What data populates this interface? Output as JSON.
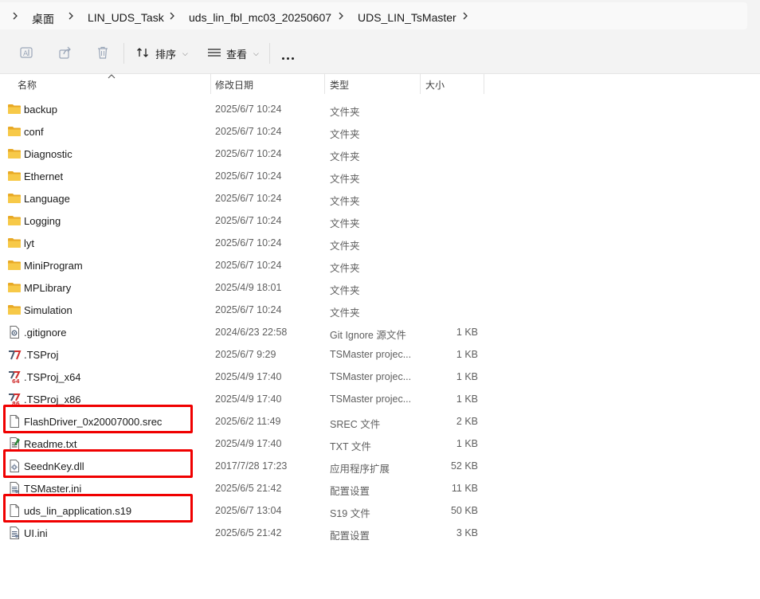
{
  "breadcrumb": [
    "桌面",
    "LIN_UDS_Task",
    "uds_lin_fbl_mc03_20250607",
    "UDS_LIN_TsMaster"
  ],
  "toolbar": {
    "sort_label": "排序",
    "view_label": "查看"
  },
  "columns": {
    "name": "名称",
    "date": "修改日期",
    "type": "类型",
    "size": "大小"
  },
  "colors": {
    "highlight": "#f00000",
    "folder": "#f7c948"
  },
  "files": [
    {
      "name": "backup",
      "date": "2025/6/7 10:24",
      "type": "文件夹",
      "size": "",
      "icon": "folder-icon",
      "highlight": false
    },
    {
      "name": "conf",
      "date": "2025/6/7 10:24",
      "type": "文件夹",
      "size": "",
      "icon": "folder-icon",
      "highlight": false
    },
    {
      "name": "Diagnostic",
      "date": "2025/6/7 10:24",
      "type": "文件夹",
      "size": "",
      "icon": "folder-icon",
      "highlight": false
    },
    {
      "name": "Ethernet",
      "date": "2025/6/7 10:24",
      "type": "文件夹",
      "size": "",
      "icon": "folder-icon",
      "highlight": false
    },
    {
      "name": "Language",
      "date": "2025/6/7 10:24",
      "type": "文件夹",
      "size": "",
      "icon": "folder-icon",
      "highlight": false
    },
    {
      "name": "Logging",
      "date": "2025/6/7 10:24",
      "type": "文件夹",
      "size": "",
      "icon": "folder-icon",
      "highlight": false
    },
    {
      "name": "lyt",
      "date": "2025/6/7 10:24",
      "type": "文件夹",
      "size": "",
      "icon": "folder-icon",
      "highlight": false
    },
    {
      "name": "MiniProgram",
      "date": "2025/6/7 10:24",
      "type": "文件夹",
      "size": "",
      "icon": "folder-icon",
      "highlight": false
    },
    {
      "name": "MPLibrary",
      "date": "2025/4/9 18:01",
      "type": "文件夹",
      "size": "",
      "icon": "folder-icon",
      "highlight": false
    },
    {
      "name": "Simulation",
      "date": "2025/6/7 10:24",
      "type": "文件夹",
      "size": "",
      "icon": "folder-icon",
      "highlight": false
    },
    {
      "name": ".gitignore",
      "date": "2024/6/23 22:58",
      "type": "Git Ignore 源文件",
      "size": "1 KB",
      "icon": "gear-file-icon",
      "highlight": false
    },
    {
      "name": ".TSProj",
      "date": "2025/6/7 9:29",
      "type": "TSMaster projec...",
      "size": "1 KB",
      "icon": "tsmaster-icon",
      "highlight": false
    },
    {
      "name": ".TSProj_x64",
      "date": "2025/4/9 17:40",
      "type": "TSMaster projec...",
      "size": "1 KB",
      "icon": "tsmaster-x64-icon",
      "highlight": false
    },
    {
      "name": ".TSProj_x86",
      "date": "2025/4/9 17:40",
      "type": "TSMaster projec...",
      "size": "1 KB",
      "icon": "tsmaster-x86-icon",
      "highlight": false
    },
    {
      "name": "FlashDriver_0x20007000.srec",
      "date": "2025/6/2 11:49",
      "type": "SREC 文件",
      "size": "2 KB",
      "icon": "file-icon",
      "highlight": true
    },
    {
      "name": "Readme.txt",
      "date": "2025/4/9 17:40",
      "type": "TXT 文件",
      "size": "1 KB",
      "icon": "text-file-icon",
      "highlight": false
    },
    {
      "name": "SeednKey.dll",
      "date": "2017/7/28 17:23",
      "type": "应用程序扩展",
      "size": "52 KB",
      "icon": "dll-file-icon",
      "highlight": true
    },
    {
      "name": "TSMaster.ini",
      "date": "2025/6/5 21:42",
      "type": "配置设置",
      "size": "11 KB",
      "icon": "ini-file-icon",
      "highlight": false
    },
    {
      "name": "uds_lin_application.s19",
      "date": "2025/6/7 13:04",
      "type": "S19 文件",
      "size": "50 KB",
      "icon": "file-icon",
      "highlight": true
    },
    {
      "name": "UI.ini",
      "date": "2025/6/5 21:42",
      "type": "配置设置",
      "size": "3 KB",
      "icon": "ini-file-icon",
      "highlight": false
    }
  ]
}
